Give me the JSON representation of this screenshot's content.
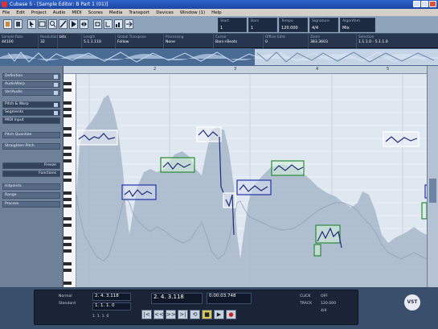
{
  "window": {
    "title": "Cubase 5 - [Sample Editor: B Part 1 (01)]"
  },
  "menu": [
    "File",
    "Edit",
    "Project",
    "Audio",
    "MIDI",
    "Scores",
    "Media",
    "Transport",
    "Devices",
    "Window (1)",
    "Help"
  ],
  "toolbar": {
    "fields": [
      {
        "label": "Start",
        "value": "1"
      },
      {
        "label": "Bars",
        "value": "1"
      },
      {
        "label": "Tempo",
        "value": "120.000"
      },
      {
        "label": "Signature",
        "value": "4/4"
      },
      {
        "label": "Algorithm",
        "value": "Mix"
      }
    ]
  },
  "infoline": {
    "columns": [
      {
        "label": "Sample Rate",
        "value": "44100"
      },
      {
        "label": "Resolution",
        "value": "32"
      },
      {
        "label": "",
        "value": "bits"
      },
      {
        "label": "Length",
        "value": "5.1.1.110"
      },
      {
        "label": "Global Transpose",
        "value": "Follow"
      },
      {
        "label": "Processing",
        "value": "None"
      },
      {
        "label": "Cursor",
        "value": "Bars+Beats"
      },
      {
        "label": "Offline Edits",
        "value": "0"
      },
      {
        "label": "Zoom",
        "value": "383.3603"
      },
      {
        "label": "Selection",
        "value": "1.1.1.0 - 5.1.1.0"
      }
    ]
  },
  "ruler": {
    "marks": [
      "2",
      "3",
      "4",
      "5"
    ]
  },
  "inspector": {
    "items": [
      {
        "label": "Definition",
        "checked": true
      },
      {
        "label": "AudioWarp",
        "checked": true
      },
      {
        "label": "VariAudio",
        "checked": true
      },
      {
        "label": "Pitch & Warp",
        "checked": true
      },
      {
        "label": "Segments",
        "checked": true
      },
      {
        "label": "MIDI Input",
        "checked": false
      },
      {
        "label": "Pitch Quantize",
        "checked": false
      },
      {
        "label": "Straighten Pitch",
        "checked": false
      },
      {
        "label": "Freeze",
        "checked": false
      },
      {
        "label": "Functions",
        "checked": false
      },
      {
        "label": "Hitpoints",
        "checked": false
      },
      {
        "label": "Range",
        "checked": false
      },
      {
        "label": "Process",
        "checked": false
      }
    ]
  },
  "transport": {
    "left_labels": [
      "Normal",
      "Standard"
    ],
    "position_primary": "2. 4. 3.118",
    "position_secondary": "2. 4. 3.118",
    "time_display": "0:00:03.748",
    "lower_values": [
      "1.  1.  1.  0",
      "1.  1.  1.  0"
    ],
    "tempo_label": "TRACK",
    "tempo_value": "120.000",
    "signature": "4/4",
    "click_label": "CLICK",
    "off_label": "OFF",
    "buttons": [
      "|<",
      "<<",
      ">>",
      ">|",
      "⟲",
      "■",
      "▶",
      "●"
    ]
  },
  "logo_text": "VST",
  "colors": {
    "segment_blue": "#2233aa",
    "segment_green": "#2a8a3a",
    "segment_white": "#ffffff"
  }
}
